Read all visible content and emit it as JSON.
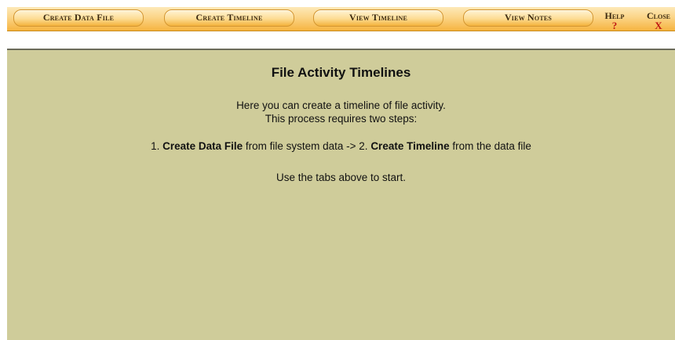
{
  "toolbar": {
    "tabs": [
      {
        "label": "Create Data File"
      },
      {
        "label": "Create Timeline"
      },
      {
        "label": "View Timeline"
      },
      {
        "label": "View Notes"
      }
    ],
    "help": {
      "label": "Help",
      "glyph": "?"
    },
    "close": {
      "label": "Close",
      "glyph": "X"
    }
  },
  "main": {
    "title": "File Activity Timelines",
    "intro_line1": "Here you can create a timeline of file activity.",
    "intro_line2": "This process requires two steps:",
    "steps": {
      "prefix_1": "1. ",
      "step1_bold": "Create Data File",
      "step1_rest": " from file system data  ->  2. ",
      "step2_bold": "Create Timeline",
      "step2_rest": " from the data file"
    },
    "hint": "Use the tabs above to start."
  },
  "colors": {
    "content_bg": "#cfcc9a",
    "toolbar_gradient_top": "#fde9b8",
    "toolbar_gradient_bottom": "#f6b440",
    "close_glyph": "#c01a14"
  }
}
